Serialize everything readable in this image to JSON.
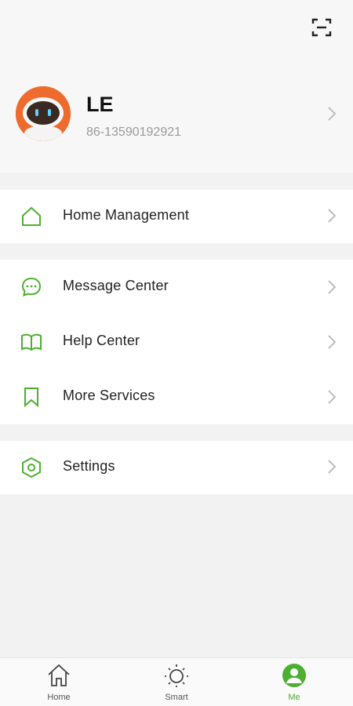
{
  "colors": {
    "accent": "#4caf30",
    "avatar_bg": "#ee6b2d"
  },
  "header": {
    "scan_icon": "scan-icon"
  },
  "profile": {
    "name": "LE",
    "phone": "86-13590192921"
  },
  "menu": {
    "home_management": "Home Management",
    "message_center": "Message Center",
    "help_center": "Help Center",
    "more_services": "More Services",
    "settings": "Settings"
  },
  "tabs": [
    {
      "label": "Home",
      "icon": "home-icon"
    },
    {
      "label": "Smart",
      "icon": "sun-icon"
    },
    {
      "label": "Me",
      "icon": "person-icon"
    }
  ]
}
